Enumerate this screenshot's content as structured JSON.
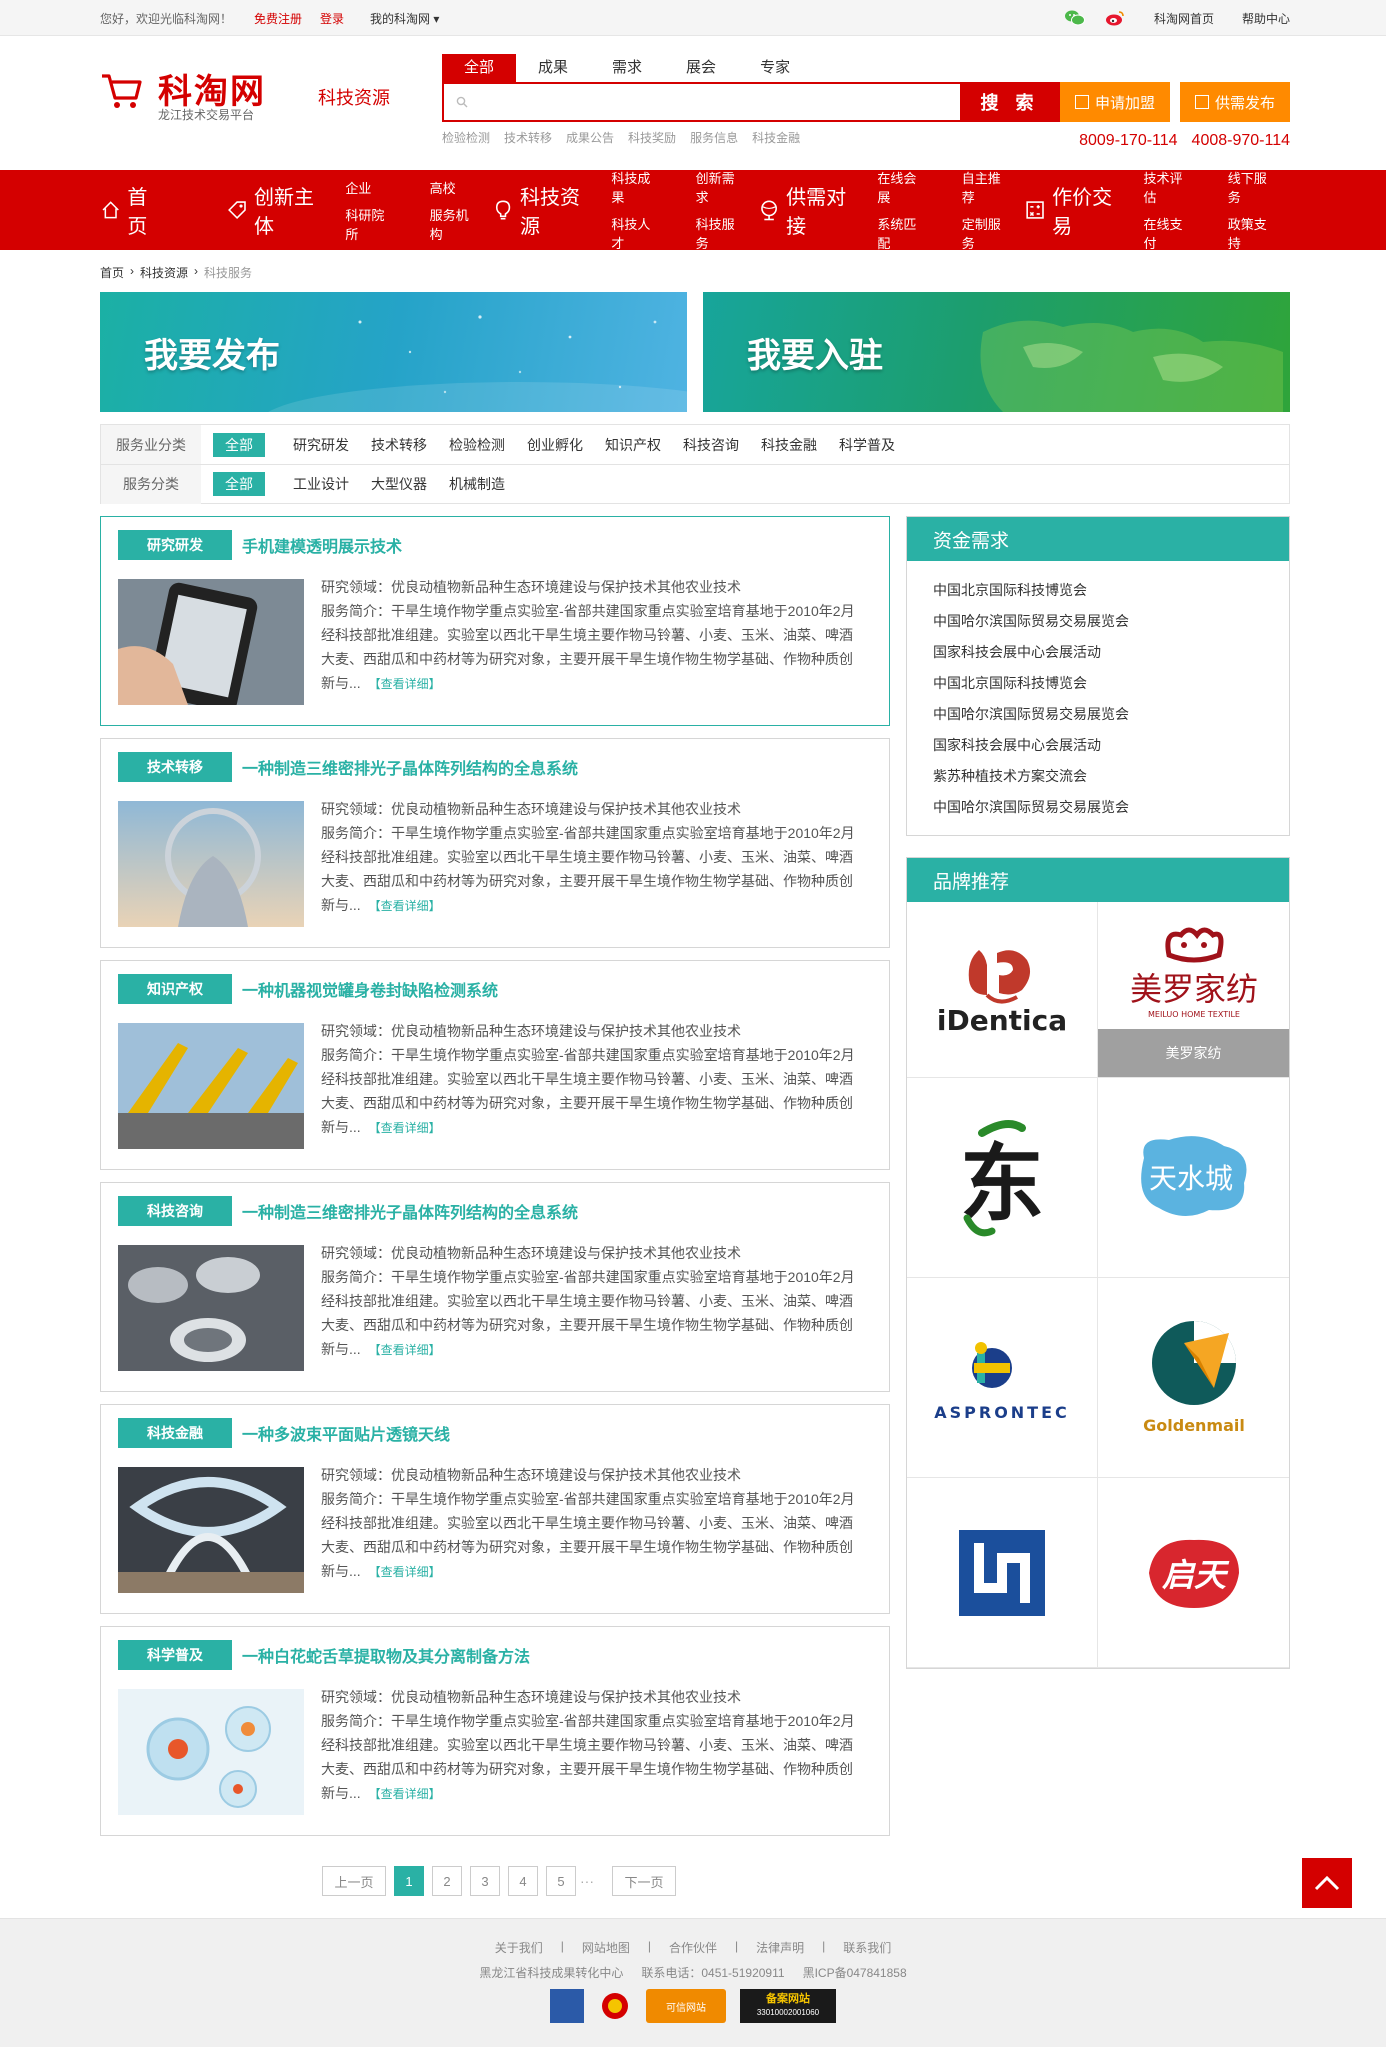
{
  "topbar": {
    "welcome": "您好，欢迎光临科淘网！",
    "register": "免费注册",
    "login": "登录",
    "my": "我的科淘网 ▾",
    "home_link": "科淘网首页",
    "help_link": "帮助中心"
  },
  "header": {
    "logo_name": "科淘网",
    "logo_sub": "龙江技术交易平台",
    "channel": "科技资源",
    "search_tabs": [
      "全部",
      "成果",
      "需求",
      "展会",
      "专家"
    ],
    "search_button": "搜 索",
    "hot": [
      "检验检测",
      "技术转移",
      "成果公告",
      "科技奖励",
      "服务信息",
      "科技金融"
    ],
    "join_button": "申请加盟",
    "publish_button": "供需发布",
    "phone1": "8009-170-114",
    "phone2": "4008-970-114"
  },
  "nav": [
    {
      "label": "首页",
      "icon": "home-icon",
      "subs": []
    },
    {
      "label": "创新主体",
      "icon": "tag-icon",
      "subs": [
        "企业",
        "高校",
        "科研院所",
        "服务机构"
      ]
    },
    {
      "label": "科技资源",
      "icon": "bulb-icon",
      "subs": [
        "科技成果",
        "创新需求",
        "科技人才",
        "科技服务"
      ]
    },
    {
      "label": "供需对接",
      "icon": "globe-icon",
      "subs": [
        "在线会展",
        "自主推荐",
        "系统匹配",
        "定制服务"
      ]
    },
    {
      "label": "作价交易",
      "icon": "calculator-icon",
      "subs": [
        "技术评估",
        "线下服务",
        "在线支付",
        "政策支持"
      ]
    }
  ],
  "breadcrumb": [
    "首页",
    "科技资源",
    "科技服务"
  ],
  "banners": {
    "publish": "我要发布",
    "settle": "我要入驻"
  },
  "filters": {
    "row1_label": "服务业分类",
    "row1": [
      "全部",
      "研究研发",
      "技术转移",
      "检验检测",
      "创业孵化",
      "知识产权",
      "科技咨询",
      "科技金融",
      "科学普及"
    ],
    "row2_label": "服务分类",
    "row2": [
      "全部",
      "工业设计",
      "大型仪器",
      "机械制造"
    ]
  },
  "items": [
    {
      "tag": "研究研发",
      "title": "手机建模透明展示技术",
      "field": "研究领域：优良动植物新品种生态环境建设与保护技术其他农业技术",
      "intro": "服务简介：干旱生境作物学重点实验室-省部共建国家重点实验室培育基地于2010年2月经科技部批准组建。实验室以西北干旱生境主要作物马铃薯、小麦、玉米、油菜、啤酒大麦、西甜瓜和中药材等为研究对象，主要开展干旱生境作物生物学基础、作物种质创新与...",
      "more": "【查看详细】"
    },
    {
      "tag": "技术转移",
      "title": "一种制造三维密排光子晶体阵列结构的全息系统",
      "field": "研究领域：优良动植物新品种生态环境建设与保护技术其他农业技术",
      "intro": "服务简介：干旱生境作物学重点实验室-省部共建国家重点实验室培育基地于2010年2月经科技部批准组建。实验室以西北干旱生境主要作物马铃薯、小麦、玉米、油菜、啤酒大麦、西甜瓜和中药材等为研究对象，主要开展干旱生境作物生物学基础、作物种质创新与...",
      "more": "【查看详细】"
    },
    {
      "tag": "知识产权",
      "title": "一种机器视觉罐身卷封缺陷检测系统",
      "field": "研究领域：优良动植物新品种生态环境建设与保护技术其他农业技术",
      "intro": "服务简介：干旱生境作物学重点实验室-省部共建国家重点实验室培育基地于2010年2月经科技部批准组建。实验室以西北干旱生境主要作物马铃薯、小麦、玉米、油菜、啤酒大麦、西甜瓜和中药材等为研究对象，主要开展干旱生境作物生物学基础、作物种质创新与...",
      "more": "【查看详细】"
    },
    {
      "tag": "科技咨询",
      "title": "一种制造三维密排光子晶体阵列结构的全息系统",
      "field": "研究领域：优良动植物新品种生态环境建设与保护技术其他农业技术",
      "intro": "服务简介：干旱生境作物学重点实验室-省部共建国家重点实验室培育基地于2010年2月经科技部批准组建。实验室以西北干旱生境主要作物马铃薯、小麦、玉米、油菜、啤酒大麦、西甜瓜和中药材等为研究对象，主要开展干旱生境作物生物学基础、作物种质创新与...",
      "more": "【查看详细】"
    },
    {
      "tag": "科技金融",
      "title": "一种多波束平面贴片透镜天线",
      "field": "研究领域：优良动植物新品种生态环境建设与保护技术其他农业技术",
      "intro": "服务简介：干旱生境作物学重点实验室-省部共建国家重点实验室培育基地于2010年2月经科技部批准组建。实验室以西北干旱生境主要作物马铃薯、小麦、玉米、油菜、啤酒大麦、西甜瓜和中药材等为研究对象，主要开展干旱生境作物生物学基础、作物种质创新与...",
      "more": "【查看详细】"
    },
    {
      "tag": "科学普及",
      "title": "一种白花蛇舌草提取物及其分离制备方法",
      "field": "研究领域：优良动植物新品种生态环境建设与保护技术其他农业技术",
      "intro": "服务简介：干旱生境作物学重点实验室-省部共建国家重点实验室培育基地于2010年2月经科技部批准组建。实验室以西北干旱生境主要作物马铃薯、小麦、玉米、油菜、啤酒大麦、西甜瓜和中药材等为研究对象，主要开展干旱生境作物生物学基础、作物种质创新与...",
      "more": "【查看详细】"
    }
  ],
  "funding": {
    "title": "资金需求",
    "items": [
      "中国北京国际科技博览会",
      "中国哈尔滨国际贸易交易展览会",
      "国家科技会展中心会展活动",
      "中国北京国际科技博览会",
      "中国哈尔滨国际贸易交易展览会",
      "国家科技会展中心会展活动",
      "紫苏种植技术方案交流会",
      "中国哈尔滨国际贸易交易展览会"
    ]
  },
  "brands": {
    "title": "品牌推荐",
    "identica": "iDentica",
    "meiluo": "美罗家纺",
    "meiluo_en": "MEILUO HOME TEXTILE",
    "meiluo_caption": "美罗家纺",
    "dong": "东",
    "tianshui": "天水城",
    "asprontec": "ASPRONTEC",
    "goldenmail": "Goldenmail",
    "qitian": "启天"
  },
  "pager": {
    "prev": "上一页",
    "pages": [
      "1",
      "2",
      "3",
      "4",
      "5"
    ],
    "dots": "···",
    "next": "下一页",
    "current": "1"
  },
  "footer": {
    "links": [
      "关于我们",
      "|",
      "网站地图",
      "|",
      "合作伙伴",
      "|",
      "法律声明",
      "|",
      "联系我们"
    ],
    "org": "黑龙江省科技成果转化中心",
    "tel": "联系电话：0451-51920911",
    "icp": "黑ICP备047841858",
    "badge1": "诚信网站",
    "badge2": "可信网站",
    "badge3": "备案网站",
    "badge3_num": "33010002001060"
  },
  "colors": {
    "brand_red": "#d40000",
    "accent_teal": "#2ab1a5",
    "orange": "#ff8a00"
  }
}
